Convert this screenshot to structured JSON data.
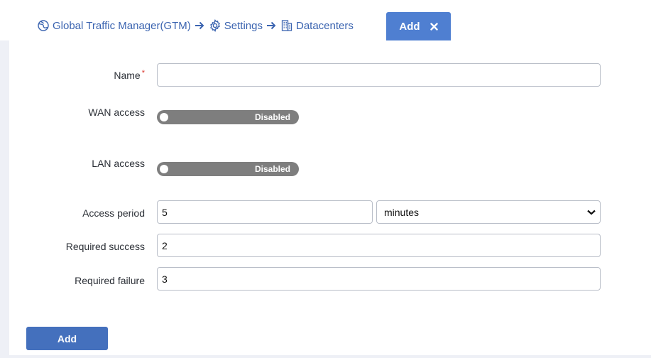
{
  "breadcrumb": {
    "items": [
      {
        "label": "Global Traffic Manager(GTM)",
        "icon": "globe-icon"
      },
      {
        "label": "Settings",
        "icon": "gear-icon"
      },
      {
        "label": "Datacenters",
        "icon": "building-icon"
      }
    ]
  },
  "tab": {
    "label": "Add",
    "close_icon": "close-icon"
  },
  "form": {
    "name": {
      "label": "Name",
      "required_mark": "*",
      "value": ""
    },
    "wan_access": {
      "label": "WAN access",
      "state": "Disabled"
    },
    "lan_access": {
      "label": "LAN access",
      "state": "Disabled"
    },
    "access_period": {
      "label": "Access period",
      "value": "5",
      "unit": "minutes"
    },
    "required_success": {
      "label": "Required success",
      "value": "2"
    },
    "required_failure": {
      "label": "Required failure",
      "value": "3"
    }
  },
  "submit": {
    "label": "Add"
  },
  "colors": {
    "accent": "#4f7fd1",
    "button": "#4470bd",
    "link": "#3b64b0",
    "toggle_off": "#7e7e7e",
    "required": "#d9342b"
  }
}
